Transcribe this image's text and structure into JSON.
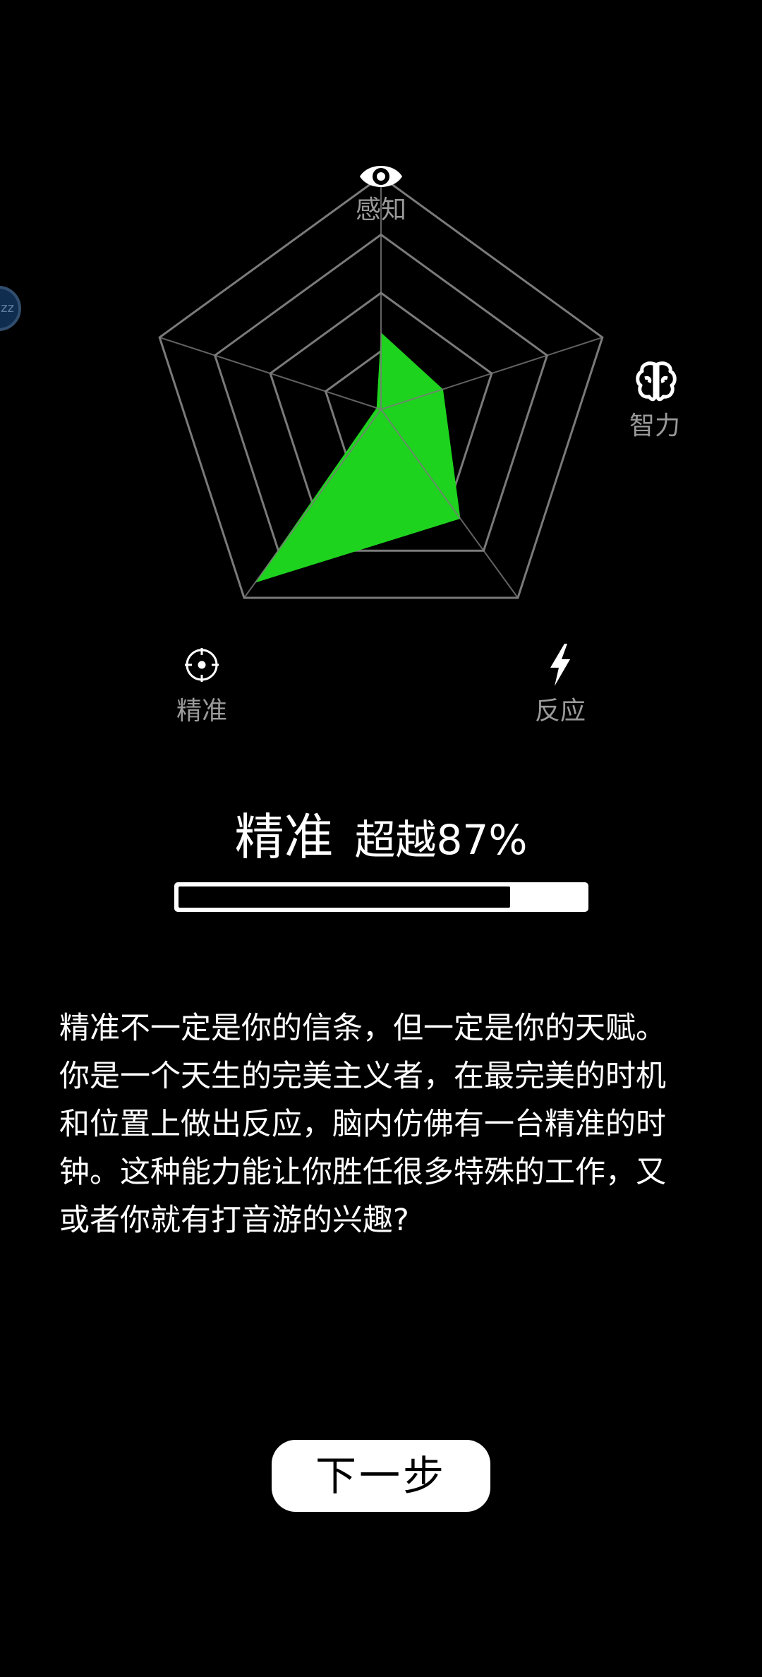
{
  "radar": {
    "axes": [
      {
        "label": "感知",
        "icon": "eye-icon"
      },
      {
        "label": "智力",
        "icon": "brain-icon"
      },
      {
        "label": "反应",
        "icon": "lightning-icon"
      },
      {
        "label": "精准",
        "icon": "crosshair-icon"
      },
      {
        "label": "",
        "icon": ""
      }
    ],
    "levels": 4,
    "max": 1,
    "values": [
      0.33,
      0.28,
      0.58,
      0.92,
      0.02
    ],
    "fill_color": "#1ed31e",
    "grid_color": "#7a7a7a"
  },
  "side_bubble": {
    "text": "zz"
  },
  "result": {
    "stat_name": "精准",
    "percentile_text": "超越87%",
    "progress_percent": 87
  },
  "description": "精准不一定是你的信条，但一定是你的天赋。你是一个天生的完美主义者，在最完美的时机和位置上做出反应，脑内仿佛有一台精准的时钟。这种能力能让你胜任很多特殊的工作，又或者你就有打音游的兴趣?",
  "next_button": {
    "label": "下一步"
  }
}
